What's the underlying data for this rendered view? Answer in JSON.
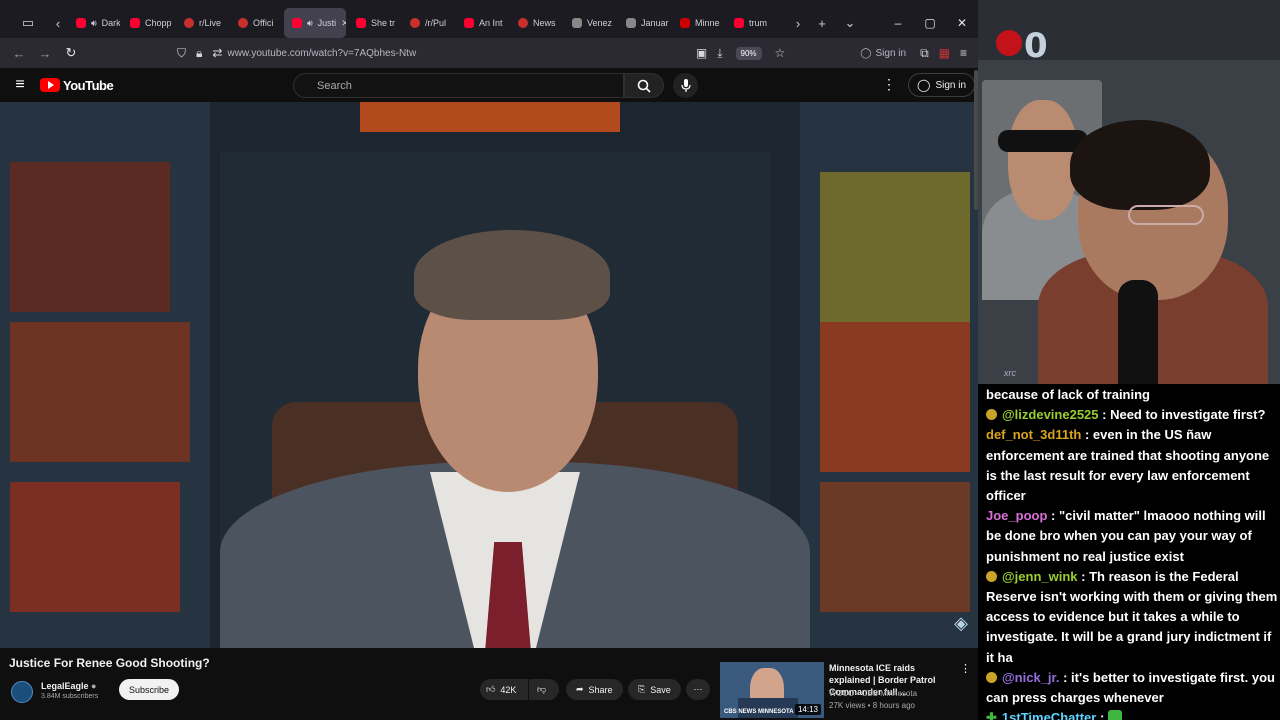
{
  "browser": {
    "tabs": [
      {
        "label": "Dark S",
        "fav": "yt",
        "speaker": true,
        "active": false
      },
      {
        "label": "Chopp",
        "fav": "yt",
        "speaker": false,
        "active": false
      },
      {
        "label": "r/Live",
        "fav": "red",
        "speaker": false,
        "active": false
      },
      {
        "label": "Offici",
        "fav": "red",
        "speaker": false,
        "active": false
      },
      {
        "label": "Justi",
        "fav": "yt",
        "speaker": true,
        "active": true
      },
      {
        "label": "She tr",
        "fav": "yt",
        "speaker": false,
        "active": false
      },
      {
        "label": "/r/Pul",
        "fav": "red",
        "speaker": false,
        "active": false
      },
      {
        "label": "An Int",
        "fav": "yt",
        "speaker": false,
        "active": false
      },
      {
        "label": "News",
        "fav": "red",
        "speaker": false,
        "active": false
      },
      {
        "label": "Venez",
        "fav": "grey",
        "speaker": false,
        "active": false
      },
      {
        "label": "Januar",
        "fav": "grey",
        "speaker": false,
        "active": false
      },
      {
        "label": "Minne",
        "fav": "cnn",
        "speaker": false,
        "active": false
      },
      {
        "label": "trum",
        "fav": "yt",
        "speaker": false,
        "active": false
      }
    ],
    "url": "www.youtube.com/watch?v=7AQbhes-Ntw",
    "zoom": "90%",
    "signin_label": "Sign in"
  },
  "youtube": {
    "logo_text": "YouTube",
    "search_placeholder": "Search",
    "signin_label": "Sign in"
  },
  "video": {
    "title": "Justice For Renee Good Shooting?",
    "channel": "LegalEagle",
    "subscribers": "3.84M subscribers",
    "subscribe_label": "Subscribe",
    "likes": "42K",
    "share_label": "Share",
    "save_label": "Save"
  },
  "recommendation": {
    "title": "Minnesota ICE raids explained | Border Patrol Commander full ...",
    "channel": "WCCO - CBS Minnesota",
    "meta": "27K views • 8 hours ago",
    "duration": "14:13",
    "thumb_logo": "CBS NEWS MINNESOTA"
  },
  "chat": {
    "messages": [
      {
        "badge": "",
        "user": "",
        "user_color": "#ffffff",
        "text": "because of lack of training"
      },
      {
        "badge": "sub",
        "user": "@lizdevine2525",
        "user_color": "#9acd32",
        "text": ": Need to investigate first?"
      },
      {
        "badge": "",
        "user": "def_not_3d11th",
        "user_color": "#daa520",
        "text": ": even in the US ñaw enforcement are trained that shooting anyone is the last result for every law enforcement officer"
      },
      {
        "badge": "",
        "user": "Joe_poop",
        "user_color": "#da70d6",
        "text": ": \"civil matter\" lmaooo nothing will be done bro when you can pay your way of punishment no real justice exist"
      },
      {
        "badge": "sub",
        "user": "@jenn_wink",
        "user_color": "#9acd32",
        "text": ": Th reason is the Federal Reserve isn't working with them or giving them access to evidence but it takes a while to investigate. It will be a grand jury indictment if it ha"
      },
      {
        "badge": "sub",
        "user": "@nick_jr.",
        "user_color": "#9370db",
        "text": ": it's better to investigate first. you can press charges whenever"
      },
      {
        "badge": "new",
        "user": "1stTimeChatter",
        "user_color": "#5fd3ff",
        "text": ":"
      }
    ]
  },
  "stream": {
    "logo_digit": "0",
    "overlay_tag": "xrc"
  }
}
